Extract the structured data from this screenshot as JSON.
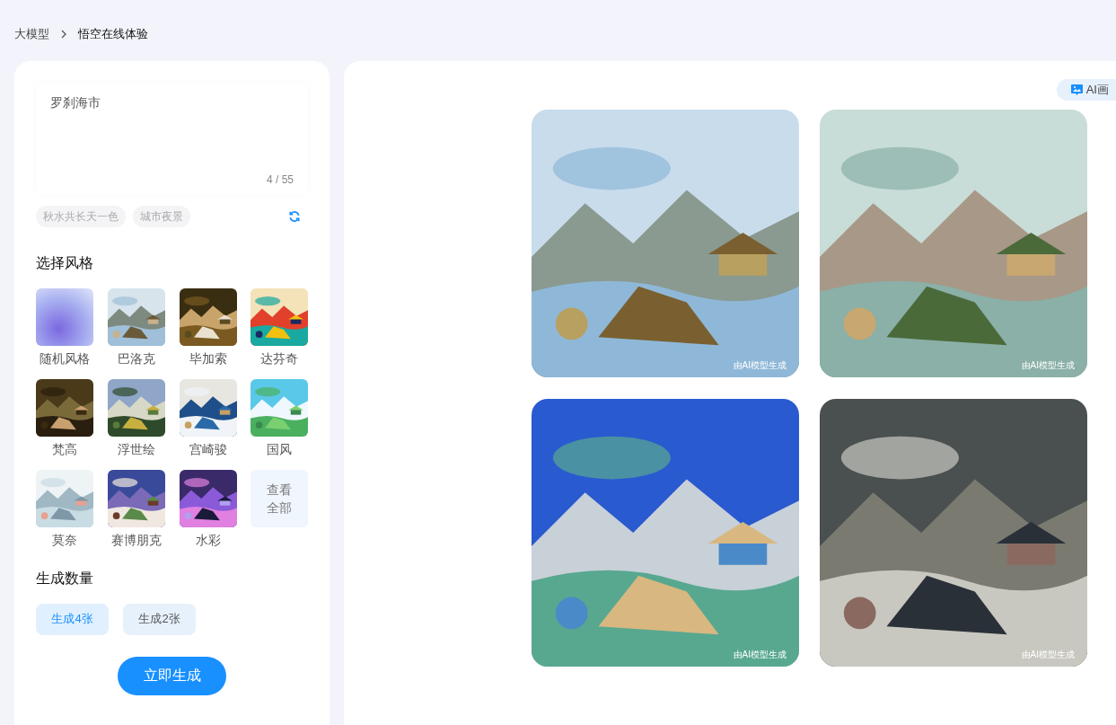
{
  "breadcrumb": [
    {
      "label": "大模型",
      "current": false
    },
    {
      "label": "悟空在线体验",
      "current": true
    }
  ],
  "prompt": {
    "value": "罗刹海市",
    "counter": "4 / 55"
  },
  "suggestions": [
    "秋水共长天一色",
    "城市夜景"
  ],
  "style_section": {
    "title": "选择风格"
  },
  "styles": [
    {
      "kind": "gradient",
      "label": "随机风格"
    },
    {
      "kind": "picture",
      "label": "巴洛克"
    },
    {
      "kind": "picture",
      "label": "毕加索"
    },
    {
      "kind": "picture",
      "label": "达芬奇"
    },
    {
      "kind": "picture",
      "label": "梵高"
    },
    {
      "kind": "picture",
      "label": "浮世绘"
    },
    {
      "kind": "picture",
      "label": "宫崎骏"
    },
    {
      "kind": "picture",
      "label": "国风"
    },
    {
      "kind": "picture",
      "label": "莫奈"
    },
    {
      "kind": "picture",
      "label": "赛博朋克"
    },
    {
      "kind": "picture",
      "label": "水彩"
    },
    {
      "kind": "more",
      "label": "查看全部"
    }
  ],
  "count_section": {
    "title": "生成数量",
    "options": [
      {
        "label": "生成4张",
        "selected": true
      },
      {
        "label": "生成2张",
        "selected": false
      }
    ]
  },
  "generate_button": "立即生成",
  "album_button": "AI画",
  "images": [
    {
      "kind": "picture",
      "caption": "由AI模型生成"
    },
    {
      "kind": "picture",
      "caption": "由AI模型生成"
    },
    {
      "kind": "picture",
      "caption": "由AI模型生成"
    },
    {
      "kind": "picture",
      "caption": "由AI模型生成"
    }
  ]
}
